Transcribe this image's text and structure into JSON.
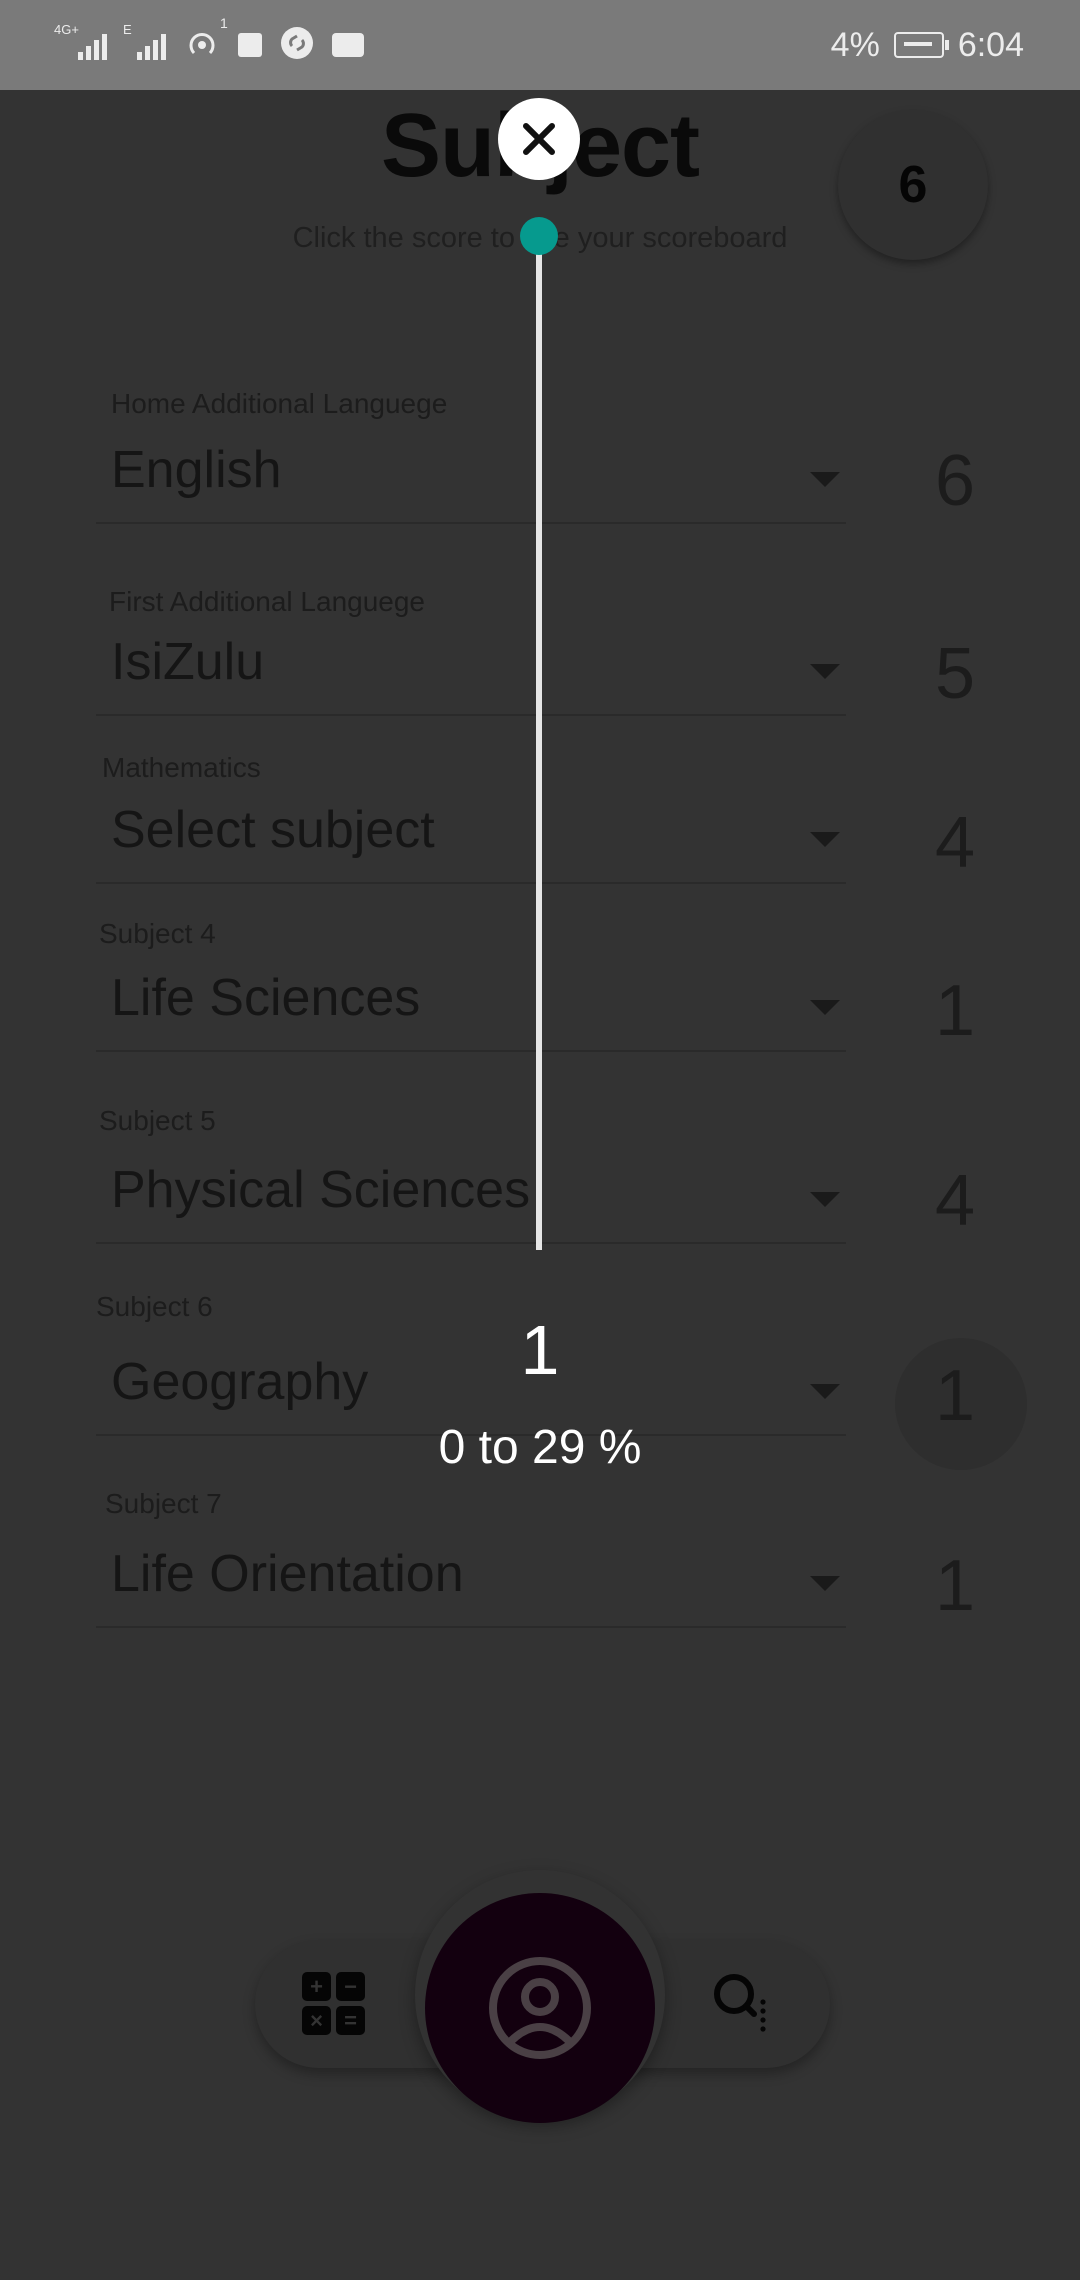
{
  "status_bar": {
    "network_1": "4G+",
    "network_2": "E",
    "hotspot_count": "1",
    "battery": "4%",
    "time": "6:04"
  },
  "header": {
    "title": "Subject",
    "subtitle": "Click the score to see your scoreboard",
    "total_score": "6"
  },
  "subjects": [
    {
      "label": "Home Additional Languege",
      "value": "English",
      "score": "6"
    },
    {
      "label": "First Additional Languege",
      "value": "IsiZulu",
      "score": "5"
    },
    {
      "label": "Mathematics",
      "value": "Select subject",
      "score": "4"
    },
    {
      "label": "Subject 4",
      "value": "Life Sciences",
      "score": "1"
    },
    {
      "label": "Subject 5",
      "value": "Physical Sciences",
      "score": "4"
    },
    {
      "label": "Subject 6",
      "value": "Geography",
      "score": "1"
    },
    {
      "label": "Subject 7",
      "value": "Life Orientation",
      "score": "1"
    }
  ],
  "calc_symbols": [
    "+",
    "−",
    "×",
    "="
  ],
  "icons": {
    "calculator": "calculator-icon",
    "profile": "profile-icon",
    "search": "search-icon",
    "close": "close-icon"
  },
  "overlay": {
    "value": "1",
    "range": "0 to 29 %"
  },
  "colors": {
    "accent_teal": "#069a8e",
    "fab": "#13000f",
    "overlay_bg": "#333333"
  }
}
